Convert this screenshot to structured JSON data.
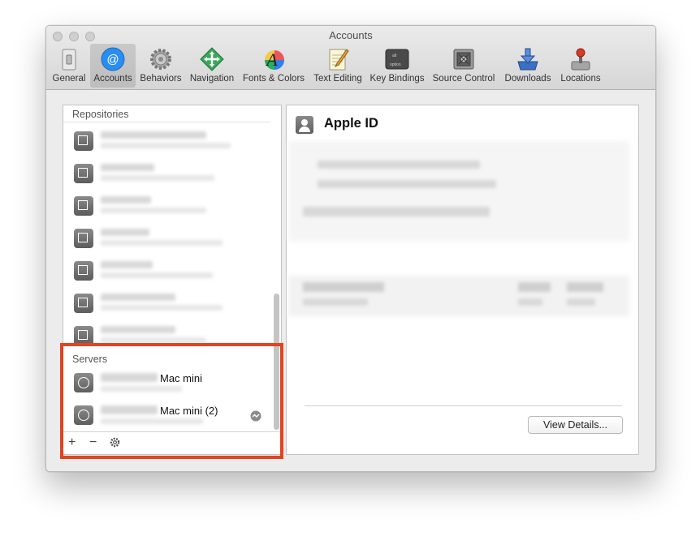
{
  "window": {
    "title": "Accounts"
  },
  "toolbar": {
    "items": [
      {
        "label": "General",
        "icon": "general-switch-icon"
      },
      {
        "label": "Accounts",
        "icon": "at-sign-icon",
        "selected": true
      },
      {
        "label": "Behaviors",
        "icon": "gear-icon"
      },
      {
        "label": "Navigation",
        "icon": "navigation-arrows-icon"
      },
      {
        "label": "Fonts & Colors",
        "icon": "font-color-icon"
      },
      {
        "label": "Text Editing",
        "icon": "notepad-pencil-icon"
      },
      {
        "label": "Key Bindings",
        "icon": "keyboard-key-icon"
      },
      {
        "label": "Source Control",
        "icon": "source-control-vault-icon"
      },
      {
        "label": "Downloads",
        "icon": "download-tray-icon"
      },
      {
        "label": "Locations",
        "icon": "joystick-icon"
      }
    ],
    "alt_key_top": "alt",
    "alt_key_bottom": "option"
  },
  "sidebar": {
    "repositories_header": "Repositories",
    "servers_header": "Servers",
    "servers": [
      {
        "name": "Mac mini"
      },
      {
        "name": "Mac mini (2)"
      }
    ]
  },
  "detail": {
    "title": "Apple ID",
    "view_details_label": "View Details..."
  },
  "colors": {
    "accent_blue": "#2a8df0",
    "highlight_red": "#e2441f"
  }
}
